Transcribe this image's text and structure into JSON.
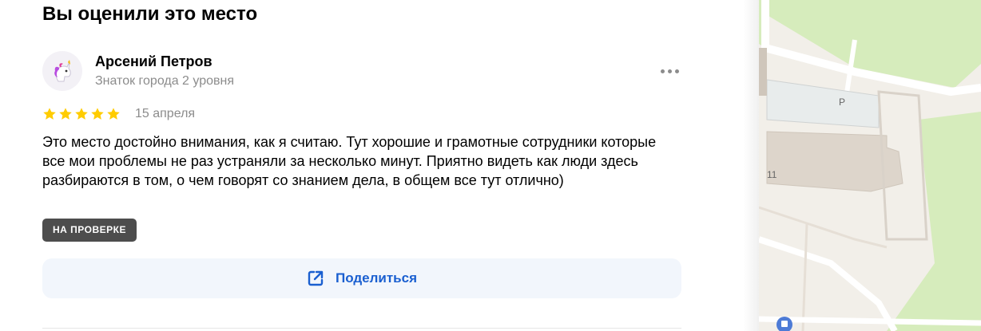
{
  "section": {
    "title": "Вы оценили это место"
  },
  "review": {
    "author": "Арсений Петров",
    "level": "Знаток города 2 уровня",
    "rating": 5,
    "rating_max": 5,
    "date": "15 апреля",
    "text": "Это место достойно внимания, как я считаю. Тут хорошие и грамотные сотрудники которые все мои проблемы не раз устраняли за несколько минут. Приятно видеть как люди здесь разбираются в том, о чем говорят со знанием дела, в общем все тут отлично)",
    "status_badge": "НА ПРОВЕРКЕ",
    "avatar_icon": "unicorn-icon",
    "menu_icon": "more-dots-icon"
  },
  "share": {
    "label": "Поделиться",
    "icon": "share-external-icon"
  },
  "map": {
    "parking_label": "P",
    "building_number": "11",
    "poi_icon": "shop-icon"
  },
  "colors": {
    "star": "#ffcc00",
    "accent": "#1a5fd0",
    "badge_bg": "#4d4d4d",
    "share_bg": "#f2f6fc",
    "map_green": "#d6ecbc",
    "map_building": "#ddd5cb",
    "map_road": "#ffffff"
  }
}
